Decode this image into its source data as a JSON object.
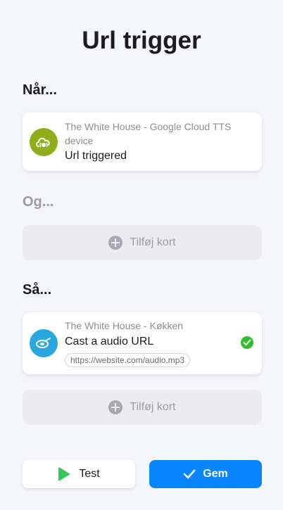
{
  "title": "Url trigger",
  "sections": {
    "when_label": "Når...",
    "and_label": "Og...",
    "then_label": "Så..."
  },
  "when_card": {
    "device": "The White House - Google Cloud TTS device",
    "trigger": "Url triggered",
    "icon": "cloud-sound-icon",
    "icon_color": "#8fae1b"
  },
  "and_add": {
    "label": "Tilføj kort"
  },
  "then_card": {
    "device": "The White House - Køkken",
    "action": "Cast a audio URL",
    "url": "https://website.com/audio.mp3",
    "icon": "cast-icon",
    "icon_color": "#29a8e0",
    "status_color": "#2fbf2f"
  },
  "then_add": {
    "label": "Tilføj kort"
  },
  "buttons": {
    "test_label": "Test",
    "save_label": "Gem"
  },
  "colors": {
    "accent": "#0a84ff",
    "play": "#34c759"
  }
}
